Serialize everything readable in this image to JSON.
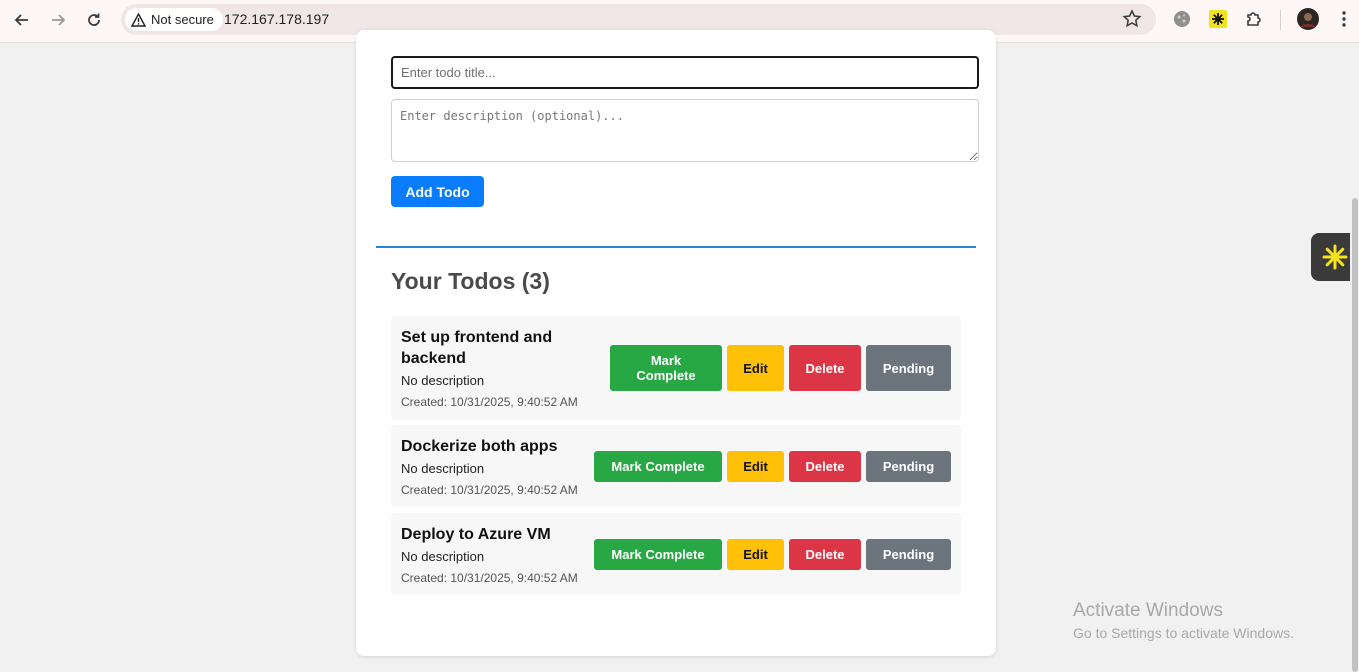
{
  "browser": {
    "security_label": "Not secure",
    "url": "172.167.178.197"
  },
  "form": {
    "title_placeholder": "Enter todo title...",
    "description_placeholder": "Enter description (optional)...",
    "add_label": "Add Todo"
  },
  "list": {
    "heading": "Your Todos (3)",
    "todos": [
      {
        "title": "Set up frontend and backend",
        "description": "No description",
        "created": "Created: 10/31/2025, 9:40:52 AM"
      },
      {
        "title": "Dockerize both apps",
        "description": "No description",
        "created": "Created: 10/31/2025, 9:40:52 AM"
      },
      {
        "title": "Deploy to Azure VM",
        "description": "No description",
        "created": "Created: 10/31/2025, 9:40:52 AM"
      }
    ],
    "actions": {
      "complete": "Mark Complete",
      "edit": "Edit",
      "delete": "Delete",
      "status": "Pending"
    }
  },
  "watermark": {
    "title": "Activate Windows",
    "subtitle": "Go to Settings to activate Windows."
  },
  "colors": {
    "primary": "#0a7cff",
    "complete": "#28a745",
    "edit": "#ffc107",
    "delete": "#dc3545",
    "pending": "#6c757d"
  }
}
